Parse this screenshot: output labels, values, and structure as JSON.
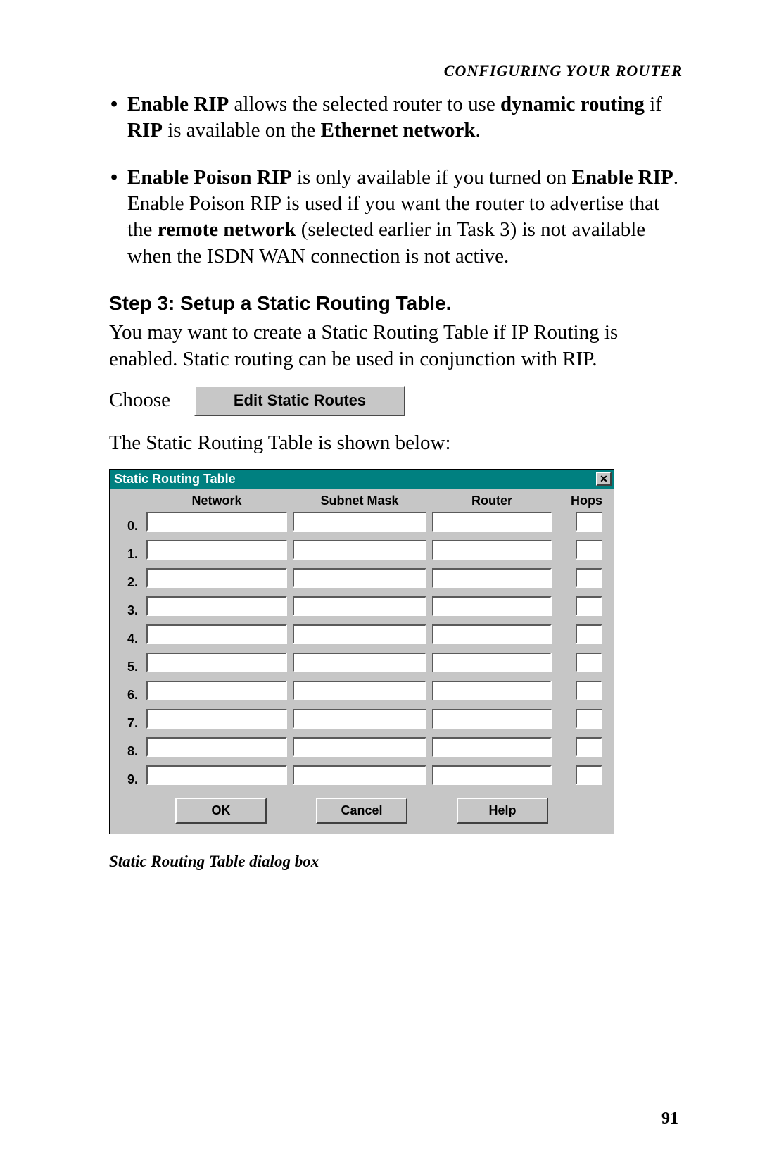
{
  "header": {
    "running": "CONFIGURING YOUR ROUTER"
  },
  "bullets": {
    "b1": {
      "seg1_b": "Enable RIP",
      "seg2": " allows the selected router to use ",
      "seg3_b": "dynamic routing",
      "seg4": " if ",
      "seg5_b": "RIP",
      "seg6": " is available on the ",
      "seg7_b": "Ethernet network",
      "seg8": "."
    },
    "b2": {
      "seg1_b": "Enable Poison RIP",
      "seg2": " is only available if you turned on ",
      "seg3_b": "Enable RIP",
      "seg4": ".  Enable Poison RIP is used if you want the router to advertise that the ",
      "seg5_b": "remote network",
      "seg6": " (selected earlier in Task 3) is not available when the ISDN WAN connection is not active."
    }
  },
  "step": {
    "heading": "Step 3: Setup a Static Routing Table.",
    "para1": "You may want to create a Static Routing Table if IP Routing is enabled. Static routing can be used in conjunction with RIP.",
    "choose": "Choose",
    "edit_btn": "Edit Static Routes",
    "para2": "The Static Routing Table is shown below:"
  },
  "dialog": {
    "title": "Static Routing Table",
    "close": "✕",
    "columns": {
      "network": "Network",
      "subnet": "Subnet Mask",
      "router": "Router",
      "hops": "Hops"
    },
    "rows": [
      "0.",
      "1.",
      "2.",
      "3.",
      "4.",
      "5.",
      "6.",
      "7.",
      "8.",
      "9."
    ],
    "ok": "OK",
    "cancel": "Cancel",
    "help": "Help"
  },
  "caption": "Static Routing Table dialog box",
  "page_number": "91"
}
